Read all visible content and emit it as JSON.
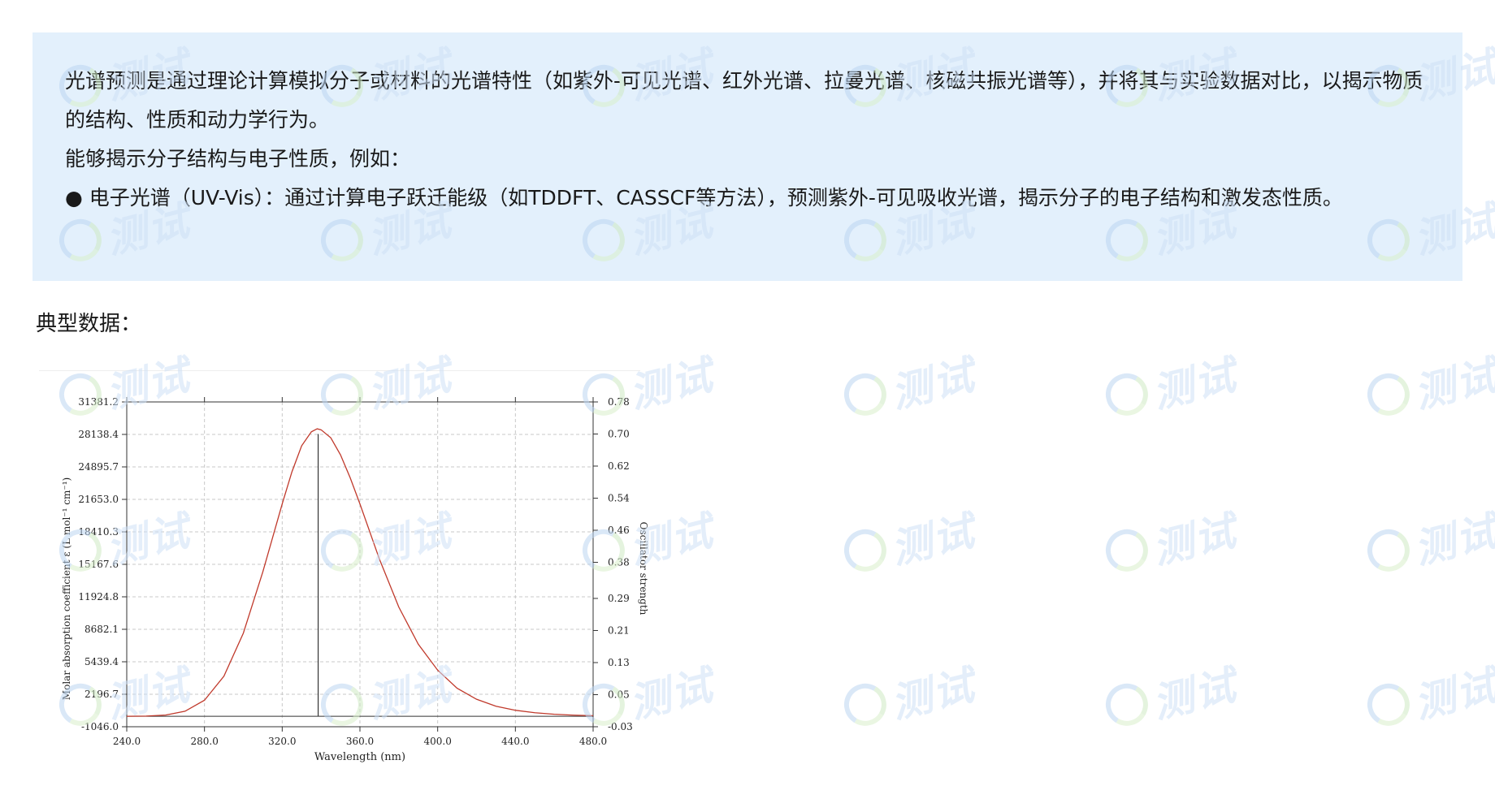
{
  "intro": {
    "paragraph1": "光谱预测是通过理论计算模拟分子或材料的光谱特性（如紫外-可见光谱、红外光谱、拉曼光谱、核磁共振光谱等），并将其与实验数据对比，以揭示物质的结构、性质和动力学行为。",
    "paragraph2": " 能够揭示分子结构与电子性质，例如：",
    "paragraph3": "● 电子光谱（UV-Vis）：通过计算电子跃迁能级（如TDDFT、CASSCF等方法），预测紫外-可见吸收光谱，揭示分子的电子结构和激发态性质。"
  },
  "section_title": "典型数据：",
  "watermark_text": "测试",
  "colors": {
    "intro_bg": "#e3f0fc",
    "curve": "#c0392b",
    "stick": "#333333",
    "grid": "#c8c8c8",
    "axis": "#333333"
  },
  "chart_data": {
    "type": "line",
    "xlabel": "Wavelength (nm)",
    "ylabel": "Molar absorption coefficient ε (L mol⁻¹ cm⁻¹)",
    "y2label": "Oscillator strength",
    "xlim": [
      240.0,
      480.0
    ],
    "ylim": [
      -1046.0,
      31381.2
    ],
    "y2lim": [
      -0.03,
      0.78
    ],
    "x_ticks": [
      "240.0",
      "280.0",
      "320.0",
      "360.0",
      "400.0",
      "440.0",
      "480.0"
    ],
    "y_ticks": [
      "-1046.0",
      "2196.7",
      "5439.4",
      "8682.1",
      "11924.8",
      "15167.6",
      "18410.3",
      "21653.0",
      "24895.7",
      "28138.4",
      "31381.2"
    ],
    "y2_ticks": [
      "-0.03",
      "0.05",
      "0.13",
      "0.21",
      "0.29",
      "0.38",
      "0.46",
      "0.54",
      "0.62",
      "0.70",
      "0.78"
    ],
    "grid": true,
    "series": [
      {
        "kind": "curve",
        "x": [
          240,
          250,
          260,
          270,
          280,
          290,
          300,
          310,
          320,
          325,
          330,
          335,
          338,
          340,
          345,
          350,
          355,
          360,
          370,
          380,
          390,
          400,
          410,
          420,
          430,
          440,
          450,
          460,
          470,
          480
        ],
        "y": [
          0,
          20,
          120,
          500,
          1600,
          4000,
          8300,
          14400,
          21200,
          24400,
          27000,
          28400,
          28700,
          28600,
          27800,
          26100,
          23800,
          21200,
          15700,
          10900,
          7200,
          4600,
          2800,
          1700,
          1000,
          600,
          350,
          200,
          110,
          60
        ]
      },
      {
        "kind": "stick",
        "x": [
          338.5
        ],
        "y": [
          0.7
        ]
      }
    ]
  }
}
